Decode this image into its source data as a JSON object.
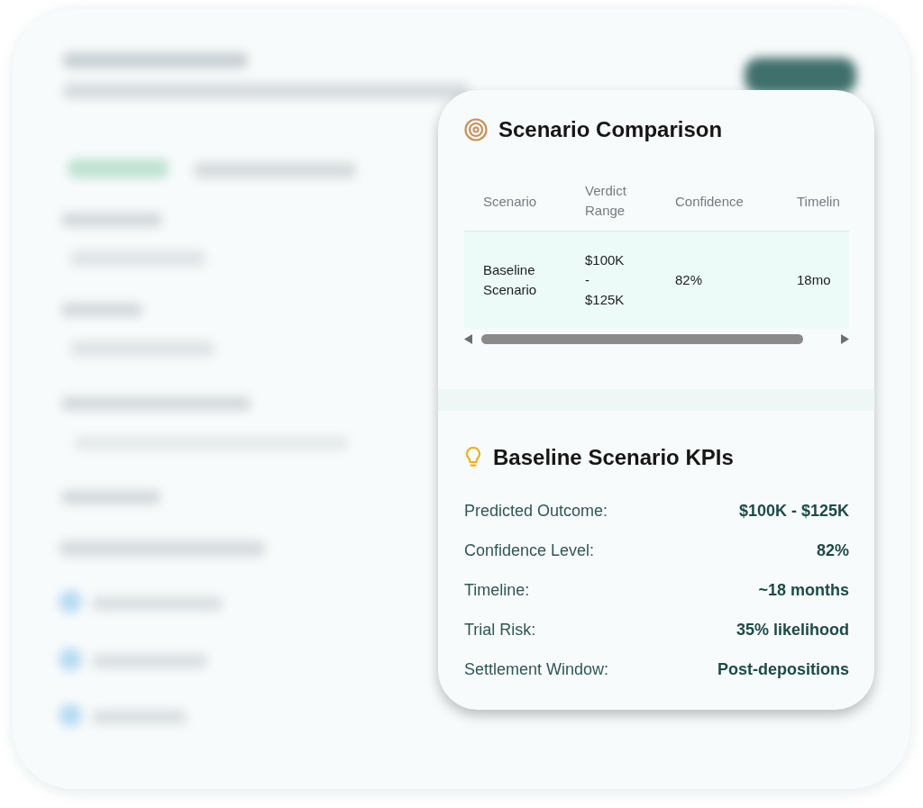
{
  "comparison": {
    "title": "Scenario Comparison",
    "columns": [
      "Scenario",
      "Verdict Range",
      "Confidence",
      "Timelin"
    ],
    "rows": [
      {
        "cells": [
          "Baseline Scenario",
          "$100K - $125K",
          "82%",
          "18mo"
        ],
        "selected": true
      }
    ]
  },
  "kpis": {
    "title": "Baseline Scenario KPIs",
    "items": [
      {
        "label": "Predicted Outcome:",
        "value": "$100K - $125K"
      },
      {
        "label": "Confidence Level:",
        "value": "82%"
      },
      {
        "label": "Timeline:",
        "value": "~18 months"
      },
      {
        "label": "Trial Risk:",
        "value": "35% likelihood"
      },
      {
        "label": "Settlement Window:",
        "value": "Post-depositions"
      }
    ]
  }
}
